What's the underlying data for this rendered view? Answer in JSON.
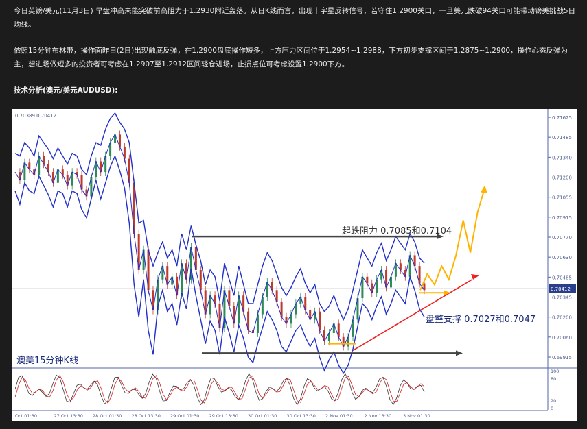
{
  "article": {
    "paragraph1": "今日英镑/美元(11月3日) 早盘冲高未能突破前高阻力于1.2930附近轰落。从日K线而言，出现十字星反转信号，若守住1.2900关口，一旦美元跌破94关口可能带动镑美挑战5日均线。",
    "paragraph2": "依照15分钟布林带，操作面昨日(2日)出现触底反弹，在1.2900盘底操作短多，上方压力区间位于1.2954~1.2988，下方初步支撑区间于1.2875~1.2900，操作心态反弹为主，想进场做短多的投资者可考虑在1.2907至1.2912区间轻仓进场，止损点位可考虑设置1.2900下方。",
    "section_heading": "技术分析(澳元/美元AUDUSD):"
  },
  "chart_data": {
    "type": "line",
    "symbol_readout": "0.70389 0.70412",
    "chart_label": "澳美15分钟K线",
    "current_price": "0.70412",
    "current_value": 0.70412,
    "y_ticks": [
      "0.71625",
      "0.71485",
      "0.71340",
      "0.71200",
      "0.71055",
      "0.70915",
      "0.70770",
      "0.70630",
      "0.70485",
      "0.70345",
      "0.70200",
      "0.70060",
      "0.69915"
    ],
    "y_range": [
      0.6985,
      0.7172
    ],
    "x_ticks": [
      "Oct 01:30",
      "27 Oct 13:30",
      "28 Oct 01:30",
      "28 Oct 13:30",
      "29 Oct 01:30",
      "29 Oct 13:30",
      "30 Oct 01:30",
      "30 Oct 13:30",
      "2 Nov 01:30",
      "2 Nov 13:30",
      "3 Nov 01:30"
    ],
    "osc_ticks": [
      "100",
      "80",
      "20",
      "0"
    ],
    "osc_range": [
      0,
      100
    ],
    "annotations": {
      "resistance": "起跌阻力 0.7085和0.7104",
      "support": "盘整支撑 0.7027和0.7047"
    },
    "levels": {
      "resistance": 0.708,
      "support": 0.6993
    },
    "close": [
      0.7128,
      0.7122,
      0.7135,
      0.713,
      0.7126,
      0.714,
      0.7134,
      0.7128,
      0.712,
      0.713,
      0.7126,
      0.7118,
      0.7128,
      0.7126,
      0.7115,
      0.711,
      0.7124,
      0.7136,
      0.7128,
      0.714,
      0.715,
      0.7156,
      0.7147,
      0.7138,
      0.712,
      0.7082,
      0.7055,
      0.707,
      0.704,
      0.7025,
      0.7048,
      0.7058,
      0.7044,
      0.705,
      0.7036,
      0.706,
      0.7048,
      0.7072,
      0.7055,
      0.704,
      0.7022,
      0.7036,
      0.703,
      0.7012,
      0.704,
      0.7028,
      0.7015,
      0.7036,
      0.7024,
      0.701,
      0.7008,
      0.7022,
      0.7035,
      0.7046,
      0.704,
      0.7031,
      0.702,
      0.7015,
      0.7022,
      0.703,
      0.7035,
      0.7025,
      0.7018,
      0.7024,
      0.701,
      0.7002,
      0.7008,
      0.7015,
      0.7005,
      0.6998,
      0.7005,
      0.7018,
      0.7034,
      0.705,
      0.7045,
      0.7038,
      0.7048,
      0.7055,
      0.7042,
      0.705,
      0.706,
      0.7055,
      0.705,
      0.7066,
      0.7058,
      0.7045,
      0.704
    ],
    "upper_band": [
      0.7142,
      0.714,
      0.715,
      0.7146,
      0.714,
      0.7155,
      0.715,
      0.7145,
      0.7138,
      0.7146,
      0.714,
      0.7134,
      0.7142,
      0.714,
      0.713,
      0.7126,
      0.714,
      0.715,
      0.7148,
      0.716,
      0.7168,
      0.7172,
      0.7165,
      0.716,
      0.715,
      0.712,
      0.709,
      0.7092,
      0.707,
      0.7058,
      0.7068,
      0.7076,
      0.7064,
      0.707,
      0.7058,
      0.7082,
      0.707,
      0.7088,
      0.7074,
      0.7062,
      0.7044,
      0.7055,
      0.705,
      0.7032,
      0.706,
      0.7048,
      0.7036,
      0.7058,
      0.7044,
      0.703,
      0.703,
      0.7044,
      0.7058,
      0.7068,
      0.7062,
      0.7052,
      0.7042,
      0.7036,
      0.7042,
      0.705,
      0.7056,
      0.7045,
      0.7038,
      0.7044,
      0.703,
      0.7024,
      0.7028,
      0.7036,
      0.7026,
      0.7018,
      0.7026,
      0.704,
      0.7055,
      0.707,
      0.7064,
      0.7058,
      0.7068,
      0.7075,
      0.7062,
      0.707,
      0.708,
      0.7075,
      0.707,
      0.7082,
      0.7076,
      0.7064,
      0.706
    ],
    "lower_band": [
      0.7114,
      0.7104,
      0.712,
      0.7114,
      0.7112,
      0.7125,
      0.7118,
      0.7111,
      0.7102,
      0.7114,
      0.7112,
      0.7102,
      0.7114,
      0.7112,
      0.71,
      0.7094,
      0.7108,
      0.7122,
      0.7108,
      0.712,
      0.7132,
      0.714,
      0.7129,
      0.7116,
      0.709,
      0.7044,
      0.702,
      0.7048,
      0.701,
      0.6992,
      0.7028,
      0.704,
      0.7024,
      0.703,
      0.7014,
      0.7038,
      0.7026,
      0.7056,
      0.7036,
      0.7018,
      0.7,
      0.7017,
      0.701,
      0.6992,
      0.702,
      0.7008,
      0.6994,
      0.7014,
      0.7004,
      0.699,
      0.6986,
      0.7,
      0.7012,
      0.7024,
      0.7018,
      0.701,
      0.6998,
      0.6994,
      0.7002,
      0.701,
      0.7014,
      0.7005,
      0.6998,
      0.7004,
      0.699,
      0.698,
      0.6988,
      0.6994,
      0.6984,
      0.6978,
      0.6984,
      0.6996,
      0.7013,
      0.703,
      0.7026,
      0.7018,
      0.7028,
      0.7035,
      0.7022,
      0.703,
      0.704,
      0.7035,
      0.703,
      0.705,
      0.704,
      0.7026,
      0.702
    ],
    "forecast_path": [
      0.704,
      0.7052,
      0.7044,
      0.7058,
      0.7048,
      0.7066,
      0.7092,
      0.7068,
      0.7098,
      0.7116
    ],
    "colors": {
      "band": "#2230c8",
      "resistance_arrow": "#444444",
      "support_arrow": "#ffb300",
      "trendline": "#ee2222",
      "bull": "#2e8b57",
      "bear": "#c0392b",
      "osc_k": "#333333",
      "osc_d": "#d62020",
      "axis_text": "#4a5a8a"
    }
  }
}
